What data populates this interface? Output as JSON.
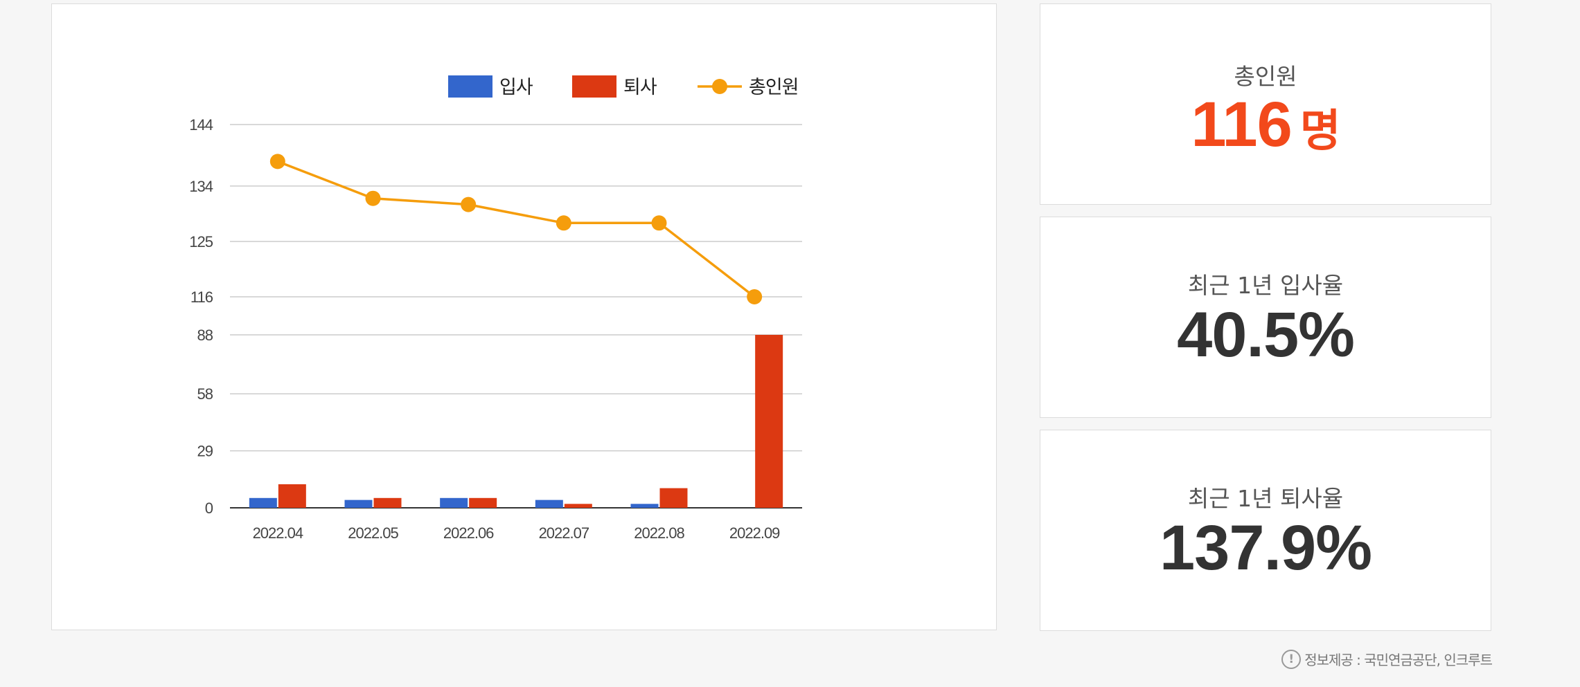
{
  "chart_data": {
    "type": "bar",
    "categories": [
      "2022.04",
      "2022.05",
      "2022.06",
      "2022.07",
      "2022.08",
      "2022.09"
    ],
    "series": [
      {
        "name": "입사",
        "kind": "bar",
        "color": "#3366cc",
        "values": [
          5,
          4,
          5,
          4,
          2,
          0
        ]
      },
      {
        "name": "퇴사",
        "kind": "bar",
        "color": "#dc3912",
        "values": [
          12,
          5,
          5,
          2,
          10,
          88
        ]
      },
      {
        "name": "총인원",
        "kind": "line",
        "color": "#f59d0c",
        "values": [
          138,
          132,
          131,
          128,
          128,
          116
        ]
      }
    ],
    "y_ticks_lower": [
      0,
      29,
      58,
      88
    ],
    "y_ticks_upper": [
      116,
      125,
      134,
      144
    ],
    "legend_position": "top",
    "grid": true
  },
  "stats": [
    {
      "label": "총인원",
      "value": "116",
      "unit": "명",
      "color": "#f2491b"
    },
    {
      "label": "최근 1년 입사율",
      "value": "40.5%",
      "unit": "",
      "color": "#333333"
    },
    {
      "label": "최근 1년 퇴사율",
      "value": "137.9%",
      "unit": "",
      "color": "#333333"
    }
  ],
  "footer": {
    "icon": "info-icon",
    "text": "정보제공 : 국민연금공단, 인크루트"
  }
}
